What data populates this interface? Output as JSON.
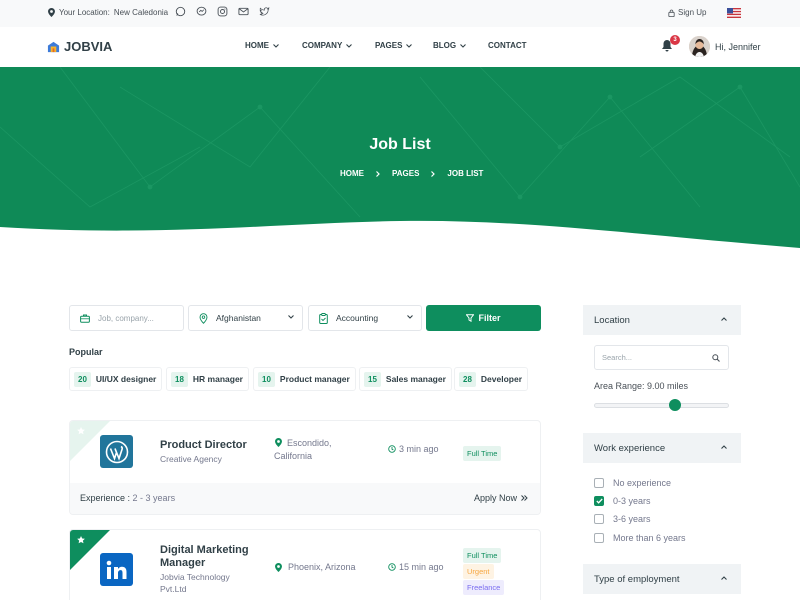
{
  "topbar": {
    "location_prefix": "Your Location:",
    "location_value": "New Caledonia",
    "signup_label": "Sign Up"
  },
  "brand": {
    "name": "JOBVIA"
  },
  "nav": {
    "items": [
      "HOME",
      "COMPANY",
      "PAGES",
      "BLOG",
      "CONTACT"
    ],
    "notification_count": "3",
    "greeting": "Hi, Jennifer"
  },
  "hero": {
    "title": "Job List",
    "breadcrumb": [
      "HOME",
      "PAGES",
      "JOB LIST"
    ]
  },
  "search": {
    "keyword_placeholder": "Job, company...",
    "country_value": "Afghanistan",
    "category_value": "Accounting",
    "filter_label": "Filter"
  },
  "popular": {
    "label": "Popular",
    "tags": [
      {
        "count": "20",
        "label": "UI/UX designer"
      },
      {
        "count": "18",
        "label": "HR manager"
      },
      {
        "count": "10",
        "label": "Product manager"
      },
      {
        "count": "15",
        "label": "Sales manager"
      },
      {
        "count": "28",
        "label": "Developer"
      }
    ]
  },
  "jobs": [
    {
      "title": "Product Director",
      "company": "Creative Agency",
      "location_line1": "Escondido,",
      "location_line2": "California",
      "posted": "3 min ago",
      "types": [
        "Full Time"
      ],
      "experience_label": "Experience :",
      "experience_value": "2 - 3 years",
      "apply_label": "Apply Now"
    },
    {
      "title_line1": "Digital Marketing",
      "title_line2": "Manager",
      "company_line1": "Jobvia Technology",
      "company_line2": "Pvt.Ltd",
      "location": "Phoenix, Arizona",
      "posted": "15 min ago",
      "types": [
        "Full Time",
        "Urgent",
        "Freelance"
      ]
    }
  ],
  "sidebar": {
    "location_title": "Location",
    "search_placeholder": "Search...",
    "area_range_label": "Area Range: 9.00 miles",
    "area_range_fraction": 0.6,
    "work_experience_title": "Work experience",
    "experience_options": [
      {
        "label": "No experience",
        "checked": false
      },
      {
        "label": "0-3 years",
        "checked": true
      },
      {
        "label": "3-6 years",
        "checked": false
      },
      {
        "label": "More than 6 years",
        "checked": false
      }
    ],
    "employment_title": "Type of employment"
  },
  "colors": {
    "brand_green": "#0e8e5e",
    "hero_green": "#0f8a57",
    "notification_red": "#da3746",
    "urgent_orange": "#f7a742",
    "freelance_purple": "#7a6cf0"
  }
}
